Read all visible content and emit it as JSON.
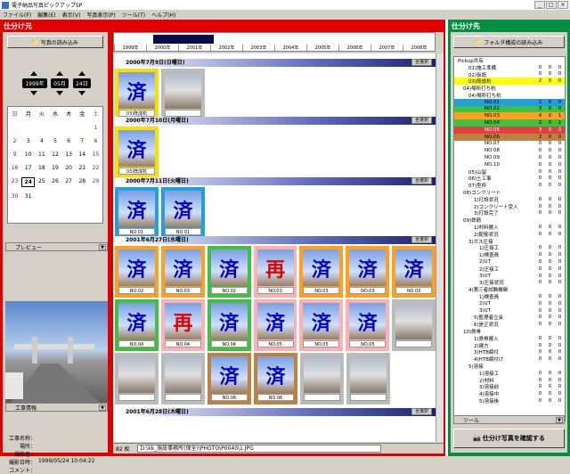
{
  "window": {
    "title": "電子納品写真ピックアップSP"
  },
  "menu": [
    "ファイル(F)",
    "編集(E)",
    "表示(V)",
    "写真表示(P)",
    "ツール(T)",
    "ヘルプ(H)"
  ],
  "left": {
    "header": "仕分け元",
    "read_button": "写真の読み込み",
    "year": "1999年",
    "month": "05月",
    "day": "24日",
    "weekdays": [
      "日",
      "月",
      "火",
      "水",
      "木",
      "金",
      "土"
    ],
    "calendar_days": [
      "",
      "",
      "",
      "",
      "",
      "",
      "1",
      "2",
      "3",
      "4",
      "5",
      "6",
      "7",
      "8",
      "9",
      "10",
      "11",
      "12",
      "13",
      "14",
      "15",
      "16",
      "17",
      "18",
      "19",
      "20",
      "21",
      "22",
      "23",
      "24",
      "25",
      "26",
      "27",
      "28",
      "29",
      "30",
      "31",
      "",
      "",
      "",
      "",
      ""
    ],
    "preview_label": "プレビュー",
    "work_info_label": "工事情報",
    "info": [
      {
        "k": "工事名称：",
        "v": ""
      },
      {
        "k": "場所：",
        "v": ""
      },
      {
        "k": "撮影者：",
        "v": ""
      },
      {
        "k": "撮影日時：",
        "v": "1999/05/24 10:04:22"
      },
      {
        "k": "コメント：",
        "v": ""
      }
    ]
  },
  "timeline": {
    "years": [
      "1999年",
      "2000年",
      "2001年",
      "2002年",
      "2003年",
      "2004年",
      "2005年",
      "2006年",
      "2007年",
      "2008年"
    ]
  },
  "groups": [
    {
      "date": "2000年7月9日(日曜日)",
      "select_all": "全選択",
      "thumbs": [
        {
          "mark": "済",
          "label": "03)既成杭",
          "border": "#ffdd00"
        },
        {
          "mark": "",
          "label": "",
          "border": "#bbbbbb"
        }
      ]
    },
    {
      "date": "2000年7月10日(月曜日)",
      "select_all": "全選択",
      "thumbs": [
        {
          "mark": "済",
          "label": "03)既成杭",
          "border": "#ffdd00"
        }
      ]
    },
    {
      "date": "2000年7月11日(火曜日)",
      "select_all": "全選択",
      "thumbs": [
        {
          "mark": "済",
          "label": "NO.01",
          "border": "#20a0e0"
        },
        {
          "mark": "済",
          "label": "NO.01",
          "border": "#20a0e0"
        }
      ]
    },
    {
      "date": "2001年6月27日(水曜日)",
      "select_all": "全選択",
      "thumbs": [
        {
          "mark": "済",
          "label": "NO.02",
          "border": "#ffa020"
        },
        {
          "mark": "済",
          "label": "NO.03",
          "border": "#ffa020"
        },
        {
          "mark": "済",
          "label": "NO.02",
          "border": "#40c040"
        },
        {
          "mark": "再",
          "label": "NO.03",
          "border": "#ffb0b0"
        },
        {
          "mark": "済",
          "label": "NO.03",
          "border": "#ffa020"
        },
        {
          "mark": "済",
          "label": "NO.03",
          "border": "#ffa020"
        },
        {
          "mark": "済",
          "label": "NO.03",
          "border": "#ffa020"
        },
        {
          "mark": "済",
          "label": "NO.04",
          "border": "#40c040"
        },
        {
          "mark": "再",
          "label": "NO.04",
          "border": "#ffb0b0"
        },
        {
          "mark": "済",
          "label": "NO.04",
          "border": "#40c040"
        },
        {
          "mark": "済",
          "label": "NO.05",
          "border": "#ffb0b0"
        },
        {
          "mark": "済",
          "label": "NO.05",
          "border": "#ffb0b0"
        },
        {
          "mark": "済",
          "label": "NO.05",
          "border": "#ffb0b0"
        },
        {
          "mark": "",
          "label": "",
          "border": "#bbbbbb"
        },
        {
          "mark": "",
          "label": "",
          "border": "#bbbbbb"
        },
        {
          "mark": "",
          "label": "",
          "border": "#bbbbbb"
        },
        {
          "mark": "済",
          "label": "NO.06",
          "border": "#c08040"
        },
        {
          "mark": "済",
          "label": "NO.06",
          "border": "#c08040"
        },
        {
          "mark": "",
          "label": "",
          "border": "#bbbbbb"
        },
        {
          "mark": "",
          "label": "",
          "border": "#bbbbbb"
        }
      ]
    },
    {
      "date": "2001年6月28日(木曜日)",
      "select_all": "全選択",
      "thumbs": []
    }
  ],
  "status": {
    "count": "82 枚",
    "path": "D:\\kk_施設事務所(保全)\\PHOTO\\P0040\\1.JPG"
  },
  "right": {
    "header": "仕分け先",
    "folder_button": "フォルダ構成の読み込み",
    "tree": [
      {
        "name": "Pickup共有",
        "a": "",
        "b": "",
        "c": "",
        "indent": 0,
        "hl": ""
      },
      {
        "name": "01)施工準備",
        "a": "0",
        "b": "0",
        "c": "0",
        "indent": 2,
        "hl": ""
      },
      {
        "name": "02)仮設",
        "a": "0",
        "b": "0",
        "c": "0",
        "indent": 2,
        "hl": ""
      },
      {
        "name": "03)既成杭",
        "a": "2",
        "b": "0",
        "c": "0",
        "indent": 2,
        "hl": "y"
      },
      {
        "name": "04)場所打ち杭",
        "a": "",
        "b": "",
        "c": "",
        "indent": 1,
        "hl": ""
      },
      {
        "name": "04)場所打ち杭",
        "a": "",
        "b": "",
        "c": "",
        "indent": 2,
        "hl": ""
      },
      {
        "name": "NO.01",
        "a": "2",
        "b": "0",
        "c": "0",
        "indent": 5,
        "hl": "c"
      },
      {
        "name": "NO.02",
        "a": "3",
        "b": "0",
        "c": "0",
        "indent": 5,
        "hl": "g"
      },
      {
        "name": "NO.03",
        "a": "4",
        "b": "0",
        "c": "1",
        "indent": 5,
        "hl": "o"
      },
      {
        "name": "NO.04",
        "a": "2",
        "b": "0",
        "c": "1",
        "indent": 5,
        "hl": "g"
      },
      {
        "name": "NO.05",
        "a": "3",
        "b": "0",
        "c": "0",
        "indent": 5,
        "hl": "r"
      },
      {
        "name": "NO.06",
        "a": "2",
        "b": "0",
        "c": "0",
        "indent": 5,
        "hl": "b"
      },
      {
        "name": "NO.07",
        "a": "0",
        "b": "0",
        "c": "0",
        "indent": 5,
        "hl": ""
      },
      {
        "name": "NO.08",
        "a": "0",
        "b": "0",
        "c": "0",
        "indent": 5,
        "hl": ""
      },
      {
        "name": "NO.09",
        "a": "0",
        "b": "0",
        "c": "0",
        "indent": 5,
        "hl": ""
      },
      {
        "name": "NO.10",
        "a": "0",
        "b": "0",
        "c": "0",
        "indent": 5,
        "hl": ""
      },
      {
        "name": "05)山留",
        "a": "0",
        "b": "0",
        "c": "0",
        "indent": 2,
        "hl": ""
      },
      {
        "name": "06)土工事",
        "a": "0",
        "b": "0",
        "c": "0",
        "indent": 2,
        "hl": ""
      },
      {
        "name": "07)型枠",
        "a": "0",
        "b": "0",
        "c": "0",
        "indent": 2,
        "hl": ""
      },
      {
        "name": "08)コンクリート",
        "a": "",
        "b": "",
        "c": "",
        "indent": 1,
        "hl": ""
      },
      {
        "name": "1)打設状況",
        "a": "0",
        "b": "0",
        "c": "0",
        "indent": 3,
        "hl": ""
      },
      {
        "name": "2)コンクリート受入",
        "a": "0",
        "b": "0",
        "c": "0",
        "indent": 3,
        "hl": ""
      },
      {
        "name": "3)打設完了",
        "a": "0",
        "b": "0",
        "c": "0",
        "indent": 3,
        "hl": ""
      },
      {
        "name": "09)鉄筋",
        "a": "",
        "b": "",
        "c": "",
        "indent": 1,
        "hl": ""
      },
      {
        "name": "1)材料搬入",
        "a": "0",
        "b": "0",
        "c": "0",
        "indent": 3,
        "hl": ""
      },
      {
        "name": "2)配筋状況",
        "a": "0",
        "b": "0",
        "c": "0",
        "indent": 3,
        "hl": ""
      },
      {
        "name": "3)ガス圧接",
        "a": "",
        "b": "",
        "c": "",
        "indent": 2,
        "hl": ""
      },
      {
        "name": "1)圧接工",
        "a": "0",
        "b": "0",
        "c": "0",
        "indent": 4,
        "hl": ""
      },
      {
        "name": "1)検査員",
        "a": "0",
        "b": "0",
        "c": "0",
        "indent": 4,
        "hl": ""
      },
      {
        "name": "2)UT",
        "a": "0",
        "b": "0",
        "c": "0",
        "indent": 4,
        "hl": ""
      },
      {
        "name": "2)圧接工",
        "a": "0",
        "b": "0",
        "c": "0",
        "indent": 4,
        "hl": ""
      },
      {
        "name": "3)UT",
        "a": "0",
        "b": "0",
        "c": "0",
        "indent": 4,
        "hl": ""
      },
      {
        "name": "3)圧接状況",
        "a": "0",
        "b": "0",
        "c": "0",
        "indent": 4,
        "hl": ""
      },
      {
        "name": "4)第三者試験機関",
        "a": "",
        "b": "",
        "c": "",
        "indent": 2,
        "hl": ""
      },
      {
        "name": "1)検査員",
        "a": "0",
        "b": "0",
        "c": "0",
        "indent": 4,
        "hl": ""
      },
      {
        "name": "2)UT",
        "a": "0",
        "b": "0",
        "c": "0",
        "indent": 4,
        "hl": ""
      },
      {
        "name": "3)UT",
        "a": "0",
        "b": "0",
        "c": "0",
        "indent": 4,
        "hl": ""
      },
      {
        "name": "5)監理者立会",
        "a": "0",
        "b": "0",
        "c": "0",
        "indent": 3,
        "hl": ""
      },
      {
        "name": "6)是正状況",
        "a": "0",
        "b": "0",
        "c": "0",
        "indent": 3,
        "hl": ""
      },
      {
        "name": "10)鉄骨",
        "a": "",
        "b": "",
        "c": "",
        "indent": 1,
        "hl": ""
      },
      {
        "name": "1)鉄骨搬入",
        "a": "0",
        "b": "0",
        "c": "0",
        "indent": 3,
        "hl": ""
      },
      {
        "name": "2)建方",
        "a": "0",
        "b": "0",
        "c": "0",
        "indent": 3,
        "hl": ""
      },
      {
        "name": "3)HTB締付",
        "a": "0",
        "b": "0",
        "c": "0",
        "indent": 3,
        "hl": ""
      },
      {
        "name": "4)HTB締付け",
        "a": "0",
        "b": "0",
        "c": "0",
        "indent": 3,
        "hl": ""
      },
      {
        "name": "5)溶接",
        "a": "",
        "b": "",
        "c": "",
        "indent": 2,
        "hl": ""
      },
      {
        "name": "1)溶接工",
        "a": "0",
        "b": "0",
        "c": "0",
        "indent": 4,
        "hl": ""
      },
      {
        "name": "2)材料",
        "a": "0",
        "b": "0",
        "c": "0",
        "indent": 4,
        "hl": ""
      },
      {
        "name": "3)溶接前",
        "a": "0",
        "b": "0",
        "c": "0",
        "indent": 4,
        "hl": ""
      },
      {
        "name": "4)溶接中",
        "a": "0",
        "b": "0",
        "c": "0",
        "indent": 4,
        "hl": ""
      },
      {
        "name": "5)溶接後",
        "a": "0",
        "b": "0",
        "c": "0",
        "indent": 4,
        "hl": ""
      }
    ],
    "tool_label": "ツール",
    "confirm_button": "仕分け写真を確認する"
  }
}
